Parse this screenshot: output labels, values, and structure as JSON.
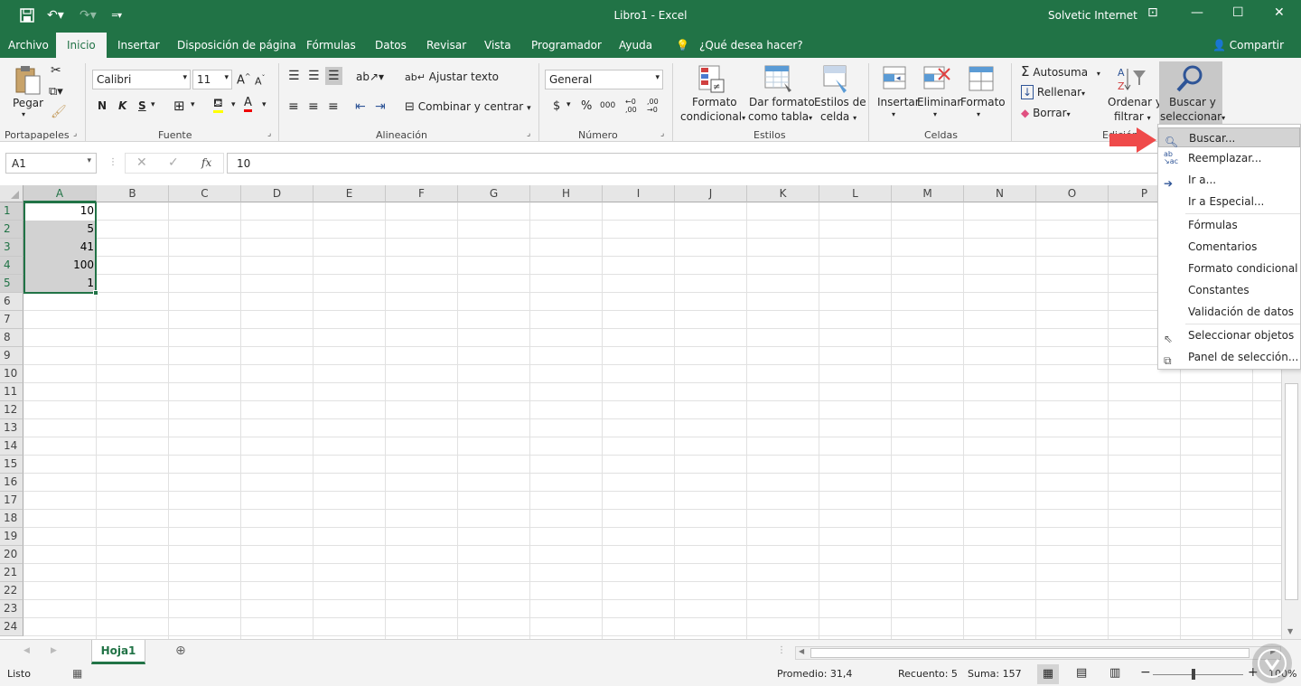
{
  "window": {
    "title": "Libro1  -  Excel",
    "user": "Solvetic Internet",
    "accent": "#217346"
  },
  "tabs": [
    "Archivo",
    "Inicio",
    "Insertar",
    "Disposición de página",
    "Fórmulas",
    "Datos",
    "Revisar",
    "Vista",
    "Programador",
    "Ayuda"
  ],
  "tell_me": "¿Qué desea hacer?",
  "share": "Compartir",
  "ribbon": {
    "clipboard": {
      "paste": "Pegar",
      "group": "Portapapeles"
    },
    "font": {
      "name": "Calibri",
      "size": "11",
      "bold": "N",
      "italic": "K",
      "underline": "S",
      "group": "Fuente"
    },
    "alignment": {
      "wrap": "Ajustar texto",
      "merge": "Combinar y centrar",
      "group": "Alineación"
    },
    "number": {
      "format": "General",
      "currency": "$",
      "percent": "%",
      "thousands": "000",
      "group": "Número"
    },
    "styles": {
      "conditional_1": "Formato",
      "conditional_2": "condicional",
      "table_1": "Dar formato",
      "table_2": "como tabla",
      "cell_1": "Estilos de",
      "cell_2": "celda",
      "group": "Estilos"
    },
    "cells": {
      "insert": "Insertar",
      "delete": "Eliminar",
      "format": "Formato",
      "group": "Celdas"
    },
    "editing": {
      "autosum": "Autosuma",
      "fill": "Rellenar",
      "clear": "Borrar",
      "sort_1": "Ordenar y",
      "sort_2": "filtrar",
      "find_1": "Buscar y",
      "find_2": "seleccionar",
      "group": "Edición"
    }
  },
  "formula_bar": {
    "name_box": "A1",
    "fx": "fx",
    "value": "10"
  },
  "columns": [
    "A",
    "B",
    "C",
    "D",
    "E",
    "F",
    "G",
    "H",
    "I",
    "J",
    "K",
    "L",
    "M",
    "N",
    "O",
    "P"
  ],
  "rows": [
    "1",
    "2",
    "3",
    "4",
    "5",
    "6",
    "7",
    "8",
    "9",
    "10",
    "11",
    "12",
    "13",
    "14",
    "15",
    "16",
    "17",
    "18",
    "19",
    "20",
    "21",
    "22",
    "23",
    "24"
  ],
  "cells_a": [
    "10",
    "5",
    "41",
    "100",
    "1"
  ],
  "sheet": {
    "name": "Hoja1"
  },
  "status": {
    "ready": "Listo",
    "average": "Promedio: 31,4",
    "count": "Recuento: 5",
    "sum": "Suma: 157",
    "zoom": "100%"
  },
  "menu": {
    "items": [
      "Buscar...",
      "Reemplazar...",
      "Ir a...",
      "Ir a Especial...",
      "Fórmulas",
      "Comentarios",
      "Formato condicional",
      "Constantes",
      "Validación de datos",
      "Seleccionar objetos",
      "Panel de selección..."
    ],
    "highlighted": "Buscar..."
  }
}
